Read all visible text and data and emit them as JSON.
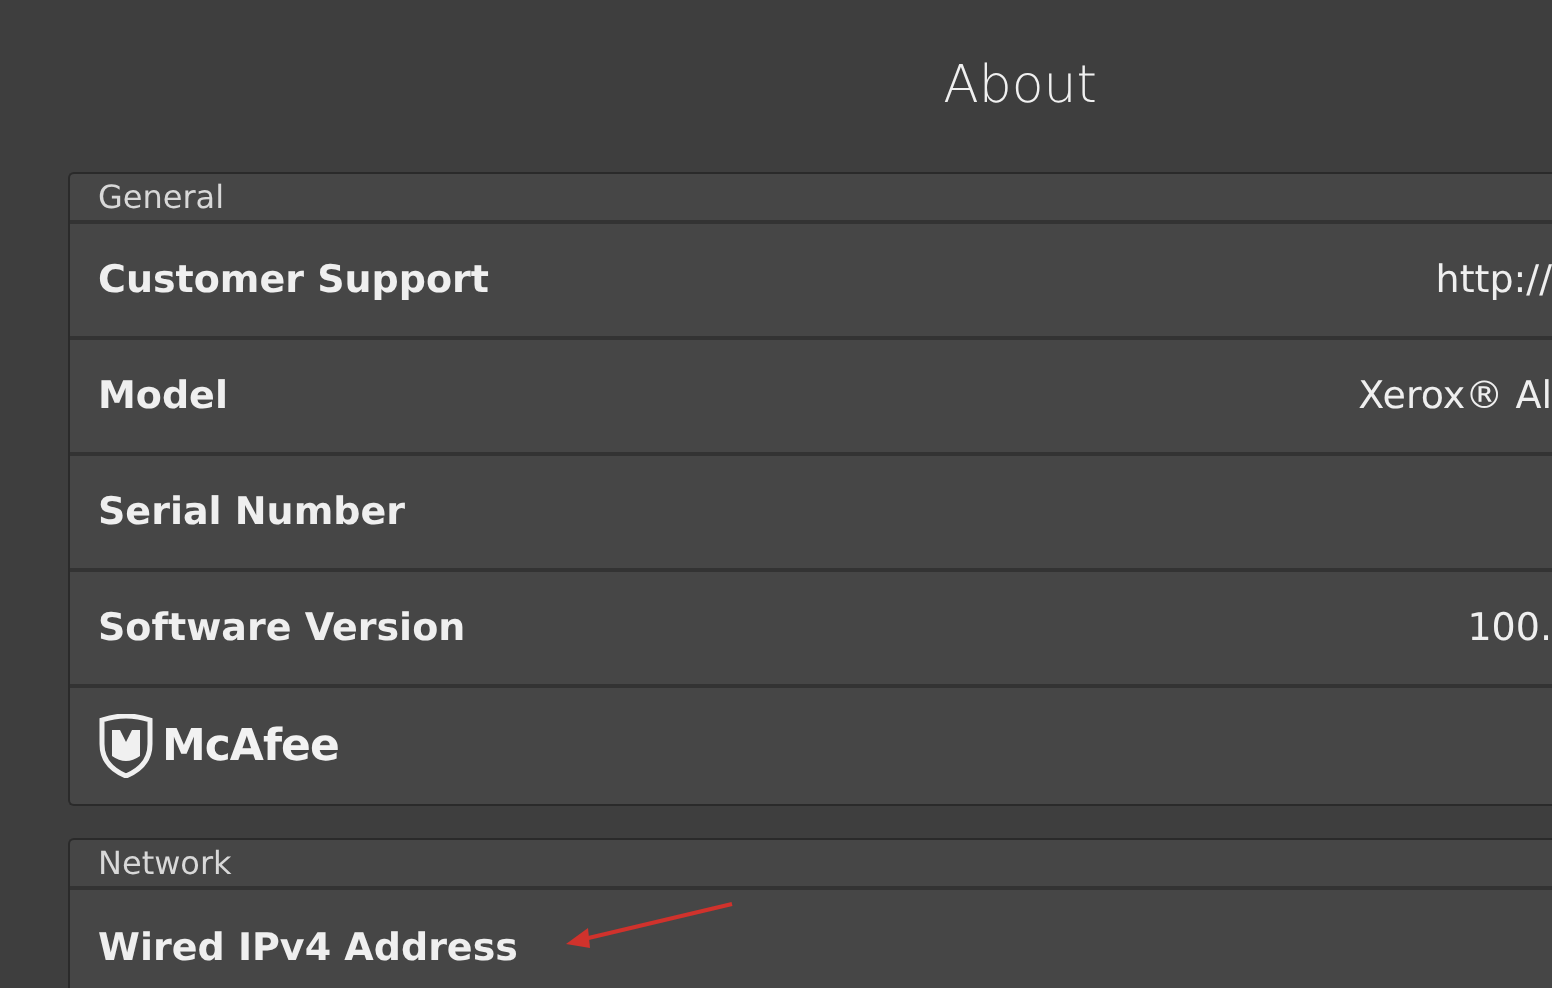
{
  "title": "About",
  "sections": [
    {
      "header": "General",
      "rows": [
        {
          "kind": "text",
          "label": "Customer Support",
          "value": "http://"
        },
        {
          "kind": "text",
          "label": "Model",
          "value": "Xerox® Al"
        },
        {
          "kind": "text",
          "label": "Serial Number"
        },
        {
          "kind": "text",
          "label": "Software Version",
          "value": "100."
        },
        {
          "kind": "logo",
          "label": "McAfee"
        }
      ]
    },
    {
      "header": "Network",
      "rows": [
        {
          "kind": "text",
          "label": "Wired IPv4 Address"
        }
      ]
    }
  ]
}
